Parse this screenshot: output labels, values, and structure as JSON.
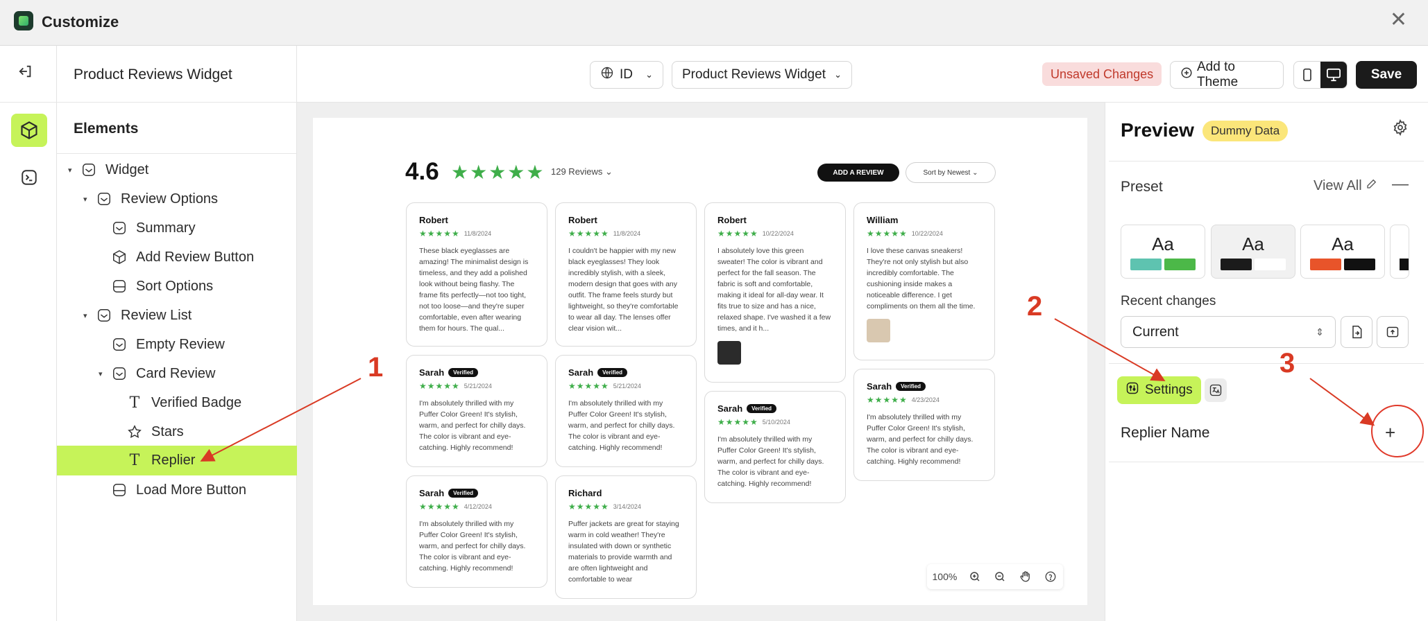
{
  "window": {
    "title": "Customize",
    "close_icon": "close-icon"
  },
  "header": {
    "page_title": "Product Reviews Widget",
    "language": "ID",
    "widget_select": "Product Reviews Widget",
    "unsaved": "Unsaved Changes",
    "add_to_theme": "Add to Theme",
    "save": "Save"
  },
  "elements": {
    "heading": "Elements",
    "tree": [
      {
        "label": "Widget"
      },
      {
        "label": "Review Options"
      },
      {
        "label": "Summary"
      },
      {
        "label": "Add Review Button"
      },
      {
        "label": "Sort Options"
      },
      {
        "label": "Review List"
      },
      {
        "label": "Empty Review"
      },
      {
        "label": "Card Review"
      },
      {
        "label": "Verified Badge"
      },
      {
        "label": "Stars"
      },
      {
        "label": "Replier"
      },
      {
        "label": "Load More Button"
      }
    ]
  },
  "canvas": {
    "rating": "4.6",
    "stars": "★★★★★",
    "review_count": "129 Reviews ⌄",
    "add_review": "ADD A REVIEW",
    "sort": "Sort by Newest ⌄",
    "verified": "Verified",
    "card_stars": "★★★★★",
    "cards": [
      {
        "name": "Robert",
        "date": "11/8/2024",
        "text": "These black eyeglasses are amazing! The minimalist design is timeless, and they add a polished look without being flashy. The frame fits perfectly—not too tight, not too loose—and they're super comfortable, even after wearing them for hours. The qual..."
      },
      {
        "name": "Robert",
        "date": "11/8/2024",
        "text": "I couldn't be happier with my new black eyeglasses! They look incredibly stylish, with a sleek, modern design that goes with any outfit. The frame feels sturdy but lightweight, so they're comfortable to wear all day. The lenses offer clear vision wit..."
      },
      {
        "name": "Robert",
        "date": "10/22/2024",
        "text": "I absolutely love this green sweater! The color is vibrant and perfect for the fall season. The fabric is soft and comfortable, making it ideal for all-day wear. It fits true to size and has a nice, relaxed shape. I've washed it a few times, and it h..."
      },
      {
        "name": "William",
        "date": "10/22/2024",
        "text": "I love these canvas sneakers! They're not only stylish but also incredibly comfortable. The cushioning inside makes a noticeable difference. I get compliments on them all the time."
      },
      {
        "name": "Sarah",
        "date": "5/21/2024",
        "text": "I'm absolutely thrilled with my Puffer Color Green! It's stylish, warm, and perfect for chilly days. The color is vibrant and eye-catching. Highly recommend!"
      },
      {
        "name": "Sarah",
        "date": "5/21/2024",
        "text": "I'm absolutely thrilled with my Puffer Color Green! It's stylish, warm, and perfect for chilly days. The color is vibrant and eye-catching. Highly recommend!"
      },
      {
        "name": "Sarah",
        "date": "5/10/2024",
        "text": "I'm absolutely thrilled with my Puffer Color Green! It's stylish, warm, and perfect for chilly days. The color is vibrant and eye-catching. Highly recommend!"
      },
      {
        "name": "Sarah",
        "date": "4/23/2024",
        "text": "I'm absolutely thrilled with my Puffer Color Green! It's stylish, warm, and perfect for chilly days. The color is vibrant and eye-catching. Highly recommend!"
      },
      {
        "name": "Sarah",
        "date": "4/12/2024",
        "text": "I'm absolutely thrilled with my Puffer Color Green! It's stylish, warm, and perfect for chilly days. The color is vibrant and eye-catching. Highly recommend!"
      },
      {
        "name": "Richard",
        "date": "3/14/2024",
        "text": "Puffer jackets are great for staying warm in cold weather! They're insulated with down or synthetic materials to provide warmth and are often lightweight and comfortable to wear"
      }
    ],
    "zoom": "100%"
  },
  "preview": {
    "title": "Preview",
    "badge": "Dummy Data",
    "preset_label": "Preset",
    "view_all": "View All",
    "preset_text": "Aa",
    "recent_changes": "Recent changes",
    "current": "Current",
    "settings_tab": "Settings",
    "replier_name": "Replier Name"
  },
  "annotations": {
    "one": "1",
    "two": "2",
    "three": "3"
  },
  "colors": {
    "accent": "#c6f359",
    "annotation": "#d93a24",
    "star": "#3fae4a"
  }
}
